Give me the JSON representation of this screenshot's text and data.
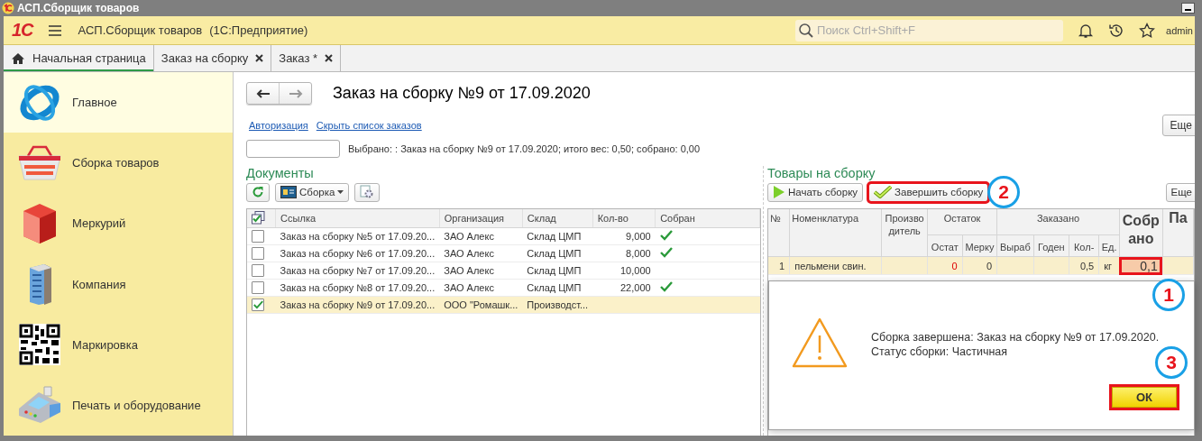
{
  "window": {
    "title": "АСП.Сборщик товаров"
  },
  "app_bar": {
    "logo": "1С",
    "app_name": "АСП.Сборщик товаров",
    "platform": "(1С:Предприятие)",
    "search": {
      "placeholder": "Поиск Ctrl+Shift+F"
    },
    "user": "admin"
  },
  "tabs": [
    {
      "label": "Начальная страница",
      "kind": "home",
      "selected": true,
      "closable": false
    },
    {
      "label": "Заказ на сборку",
      "kind": "document",
      "selected": false,
      "closable": true
    },
    {
      "label": "Заказ *",
      "kind": "document",
      "selected": false,
      "closable": true
    }
  ],
  "sidebar": {
    "items": [
      {
        "label": "Главное",
        "selected": true
      },
      {
        "label": "Сборка товаров",
        "selected": false
      },
      {
        "label": "Меркурий",
        "selected": false
      },
      {
        "label": "Компания",
        "selected": false
      },
      {
        "label": "Маркировка",
        "selected": false
      },
      {
        "label": "Печать и оборудование",
        "selected": false
      }
    ]
  },
  "form": {
    "title": "Заказ на сборку №9 от 17.09.2020",
    "links": [
      "Авторизация",
      "Скрыть список заказов"
    ],
    "more_button": "Еще",
    "summary": "Выбрано: : Заказ на сборку №9 от 17.09.2020; итого вес: 0,50; собрано: 0,00",
    "documents": {
      "heading": "Документы",
      "menu_button": "Сборка",
      "columns": [
        "Ссылка",
        "Организация",
        "Склад",
        "Кол-во",
        "Собран"
      ],
      "rows": [
        {
          "link": "Заказ на сборку №5 от 17.09.20...",
          "organization": "ЗАО Алекс",
          "warehouse": "Склад ЦМП",
          "qty": "9,000",
          "collected": true,
          "checked": false,
          "selected": false
        },
        {
          "link": "Заказ на сборку №6 от 17.09.20...",
          "organization": "ЗАО Алекс",
          "warehouse": "Склад ЦМП",
          "qty": "8,000",
          "collected": true,
          "checked": false,
          "selected": false
        },
        {
          "link": "Заказ на сборку №7 от 17.09.20...",
          "organization": "ЗАО Алекс",
          "warehouse": "Склад ЦМП",
          "qty": "10,000",
          "collected": false,
          "checked": false,
          "selected": false
        },
        {
          "link": "Заказ на сборку №8 от 17.09.20...",
          "organization": "ЗАО Алекс",
          "warehouse": "Склад ЦМП",
          "qty": "22,000",
          "collected": true,
          "checked": false,
          "selected": false
        },
        {
          "link": "Заказ на сборку №9 от 17.09.20...",
          "organization": "ООО \"Ромашк...",
          "warehouse": "Производст...",
          "collected": false,
          "checked": true,
          "selected": true
        }
      ]
    },
    "goods": {
      "heading": "Товары на сборку",
      "buttons": [
        {
          "label": "Начать сборку",
          "kind": "start",
          "highlighted": false
        },
        {
          "label": "Завершить сборку",
          "kind": "finish",
          "highlighted": true
        }
      ],
      "more_button": "Еще",
      "columns": [
        {
          "label": "№"
        },
        {
          "label": "Номенклатура"
        },
        {
          "label": "Производитель"
        },
        {
          "label": "Остаток",
          "children": [
            {
              "label": "Остат"
            },
            {
              "label": "Мерку"
            }
          ]
        },
        {
          "label": "Заказано",
          "children": [
            {
              "label": "Выраб"
            },
            {
              "label": "Годен"
            },
            {
              "label": "Кол-"
            },
            {
              "label": "Ед."
            }
          ]
        },
        {
          "label": "Собрано"
        },
        {
          "label": "Па"
        }
      ],
      "rows": [
        {
          "no": "1",
          "name": "пельмени свин.",
          "stock": "0",
          "stock_low": true,
          "mercury": "0",
          "qty": "0,5",
          "unit": "кг",
          "collected": "0,1",
          "collected_highlighted": true
        }
      ]
    }
  },
  "dialog": {
    "lines": [
      "Сборка завершена: Заказ на сборку №9 от 17.09.2020.",
      "Статус сборки: Частичная"
    ],
    "ok_button": {
      "label": "ОК",
      "highlighted": true
    }
  },
  "callouts": [
    {
      "number": "2"
    },
    {
      "number": "1"
    },
    {
      "number": "3"
    }
  ]
}
